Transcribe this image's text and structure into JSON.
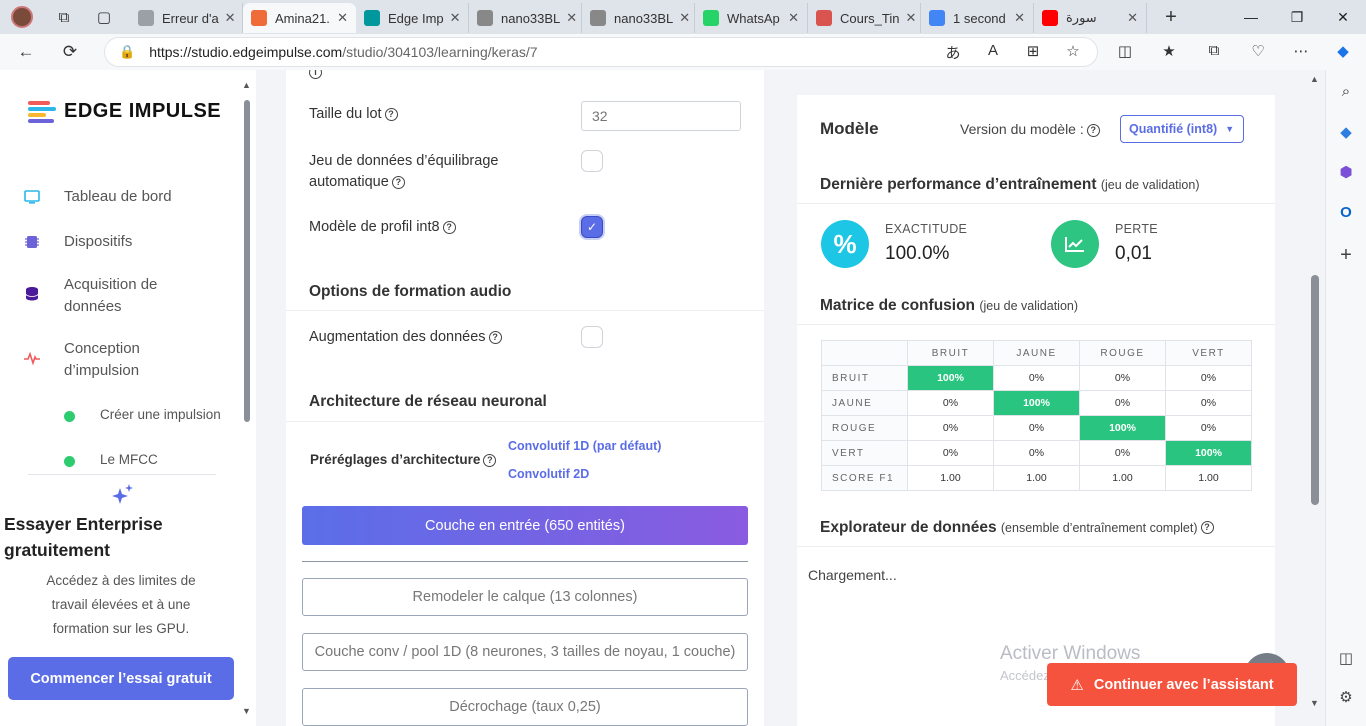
{
  "browser": {
    "tabs": [
      {
        "label": "Erreur d'a",
        "color": "#9aa0a6"
      },
      {
        "label": "Amina21.",
        "color": "#f06b3a",
        "active": true
      },
      {
        "label": "Edge Imp",
        "color": "#00979d"
      },
      {
        "label": "nano33BL",
        "color": "#888"
      },
      {
        "label": "nano33BL",
        "color": "#888"
      },
      {
        "label": "WhatsAp",
        "color": "#25d366"
      },
      {
        "label": "Cours_Tin",
        "color": "#d9534f"
      },
      {
        "label": "1 second",
        "color": "#4285f4"
      },
      {
        "label": "سورة",
        "color": "#ff0000"
      }
    ],
    "url": "https://studio.edgeimpulse.com/studio/304103/learning/keras/7",
    "url_host": "https://studio.edgeimpulse.com",
    "url_path": "/studio/304103/learning/keras/7"
  },
  "sidebar": {
    "brand": "EDGE IMPULSE",
    "items": [
      {
        "label": "Tableau de bord"
      },
      {
        "label": "Dispositifs"
      },
      {
        "label": "Acquisition de données"
      },
      {
        "label": "Conception d’impulsion"
      }
    ],
    "subitems": [
      {
        "label": "Créer une impulsion"
      },
      {
        "label": "Le MFCC"
      }
    ],
    "promo": {
      "title": "Essayer Enterprise gratuitement",
      "text": "Accédez à des limites de travail élevées et à une formation sur les GPU.",
      "cta": "Commencer l’essai gratuit"
    }
  },
  "training": {
    "batch_label": "Taille du lot",
    "batch_placeholder": "32",
    "autobalance_label": "Jeu de données d’équilibrage automatique",
    "int8_label": "Modèle de profil int8",
    "int8_checked": true,
    "audio_section": "Options de formation audio",
    "augmentation_label": "Augmentation des données",
    "arch_section": "Architecture de réseau neuronal",
    "presets_label": "Préréglages d’architecture",
    "preset_1d": "Convolutif 1D (par défaut)",
    "preset_2d": "Convolutif 2D",
    "input_layer": "Couche en entrée (650 entités)",
    "layers": [
      "Remodeler le calque (13 colonnes)",
      "Couche conv / pool 1D (8 neurones, 3 tailles de noyau, 1 couche)",
      "Décrochage (taux 0,25)"
    ]
  },
  "model": {
    "title": "Modèle",
    "version_label": "Version du modèle :",
    "version_value": "Quantifié (int8)",
    "perf_title": "Dernière performance d’entraînement",
    "perf_sub": "(jeu de validation)",
    "accuracy_label": "EXACTITUDE",
    "accuracy_value": "100.0%",
    "loss_label": "PERTE",
    "loss_value": "0,01",
    "accent_teal": "#1ec6e6",
    "accent_green": "#2dc581",
    "cm_title": "Matrice de confusion",
    "cm_sub": "(jeu de validation)",
    "cm_columns": [
      "BRUIT",
      "JAUNE",
      "ROUGE",
      "VERT"
    ],
    "cm_rows": [
      {
        "label": "BRUIT",
        "cells": [
          "100%",
          "0%",
          "0%",
          "0%"
        ]
      },
      {
        "label": "JAUNE",
        "cells": [
          "0%",
          "100%",
          "0%",
          "0%"
        ]
      },
      {
        "label": "ROUGE",
        "cells": [
          "0%",
          "0%",
          "100%",
          "0%"
        ]
      },
      {
        "label": "VERT",
        "cells": [
          "0%",
          "0%",
          "0%",
          "100%"
        ]
      },
      {
        "label": "SCORE F1",
        "cells": [
          "1.00",
          "1.00",
          "1.00",
          "1.00"
        ]
      }
    ],
    "explorer_title": "Explorateur de données",
    "explorer_sub": "(ensemble d’entraînement complet)",
    "loading": "Chargement..."
  },
  "overlay": {
    "watermark_title": "Activer Windows",
    "watermark_sub": "Accédez aux paramètres pour activer Windows.",
    "assistant": "Continuer avec l’assistant",
    "assistant_color": "#f5533d"
  }
}
